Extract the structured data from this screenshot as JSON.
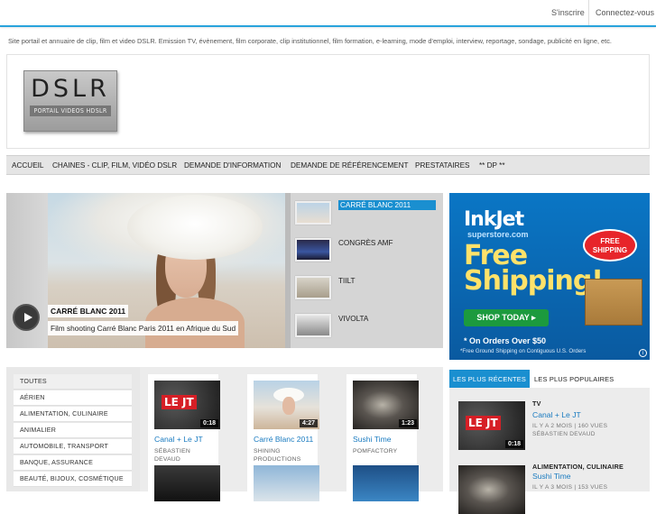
{
  "topbar": {
    "signup": "S'inscrire",
    "login": "Connectez-vous"
  },
  "tagline": "Site portail et annuaire de clip, film et video DSLR. Emission TV, évènement, film corporate, clip institutionnel, film formation, e-learning, mode d'emploi, interview, reportage, sondage, publicité en ligne, etc.",
  "logo": {
    "big": "DSLR",
    "small": "PORTAIL VIDEOS HDSLR"
  },
  "nav": [
    "ACCUEIL",
    "CHAINES - CLIP, FILM, VIDÉO DSLR",
    "DEMANDE D'INFORMATION",
    "DEMANDE DE RÉFÉRENCEMENT",
    "PRESTATAIRES",
    "** DP **"
  ],
  "slider": {
    "title": "CARRÉ BLANC 2011",
    "description": "Film shooting Carré Blanc Paris 2011 en Afrique du Sud",
    "items": [
      "CARRÉ BLANC 2011",
      "CONGRÈS AMF",
      "TIILT",
      "VIVOLTA"
    ]
  },
  "ad": {
    "brand": "InkJet",
    "sub": "superstore.com",
    "free_line1": "Free",
    "free_line2": "Shipping!",
    "badge": "FREE SHIPPING",
    "cta": "SHOP TODAY ▸",
    "orders": "* On Orders Over $50",
    "fine": "*Free Ground Shipping on Contiguous U.S. Orders",
    "info": "i"
  },
  "categories": [
    "TOUTES",
    "AÉRIEN",
    "ALIMENTATION, CULINAIRE",
    "ANIMALIER",
    "AUTOMOBILE, TRANSPORT",
    "BANQUE, ASSURANCE",
    "BEAUTÉ, BIJOUX, COSMÉTIQUE"
  ],
  "videos": [
    {
      "title": "Canal + Le JT",
      "author": "SÉBASTIEN DEVAUD",
      "duration": "0:18",
      "overlay": "LE JT"
    },
    {
      "title": "Carré Blanc 2011",
      "author": "SHINING PRODUCTIONS",
      "duration": "4:27"
    },
    {
      "title": "Sushi Time",
      "author": "POMFACTORY",
      "duration": "1:23"
    }
  ],
  "tabs": {
    "recent": "LES PLUS RÉCENTES",
    "popular": "LES PLUS POPULAIRES"
  },
  "recent": [
    {
      "category": "TV",
      "title": "Canal + Le JT",
      "meta": "IL Y A 2 MOIS | 160 VUES",
      "author": "SÉBASTIEN DEVAUD",
      "duration": "0:18",
      "overlay": "LE JT"
    },
    {
      "category": "ALIMENTATION, CULINAIRE",
      "title": "Sushi Time",
      "meta": "IL Y A 3 MOIS | 153 VUES"
    }
  ]
}
